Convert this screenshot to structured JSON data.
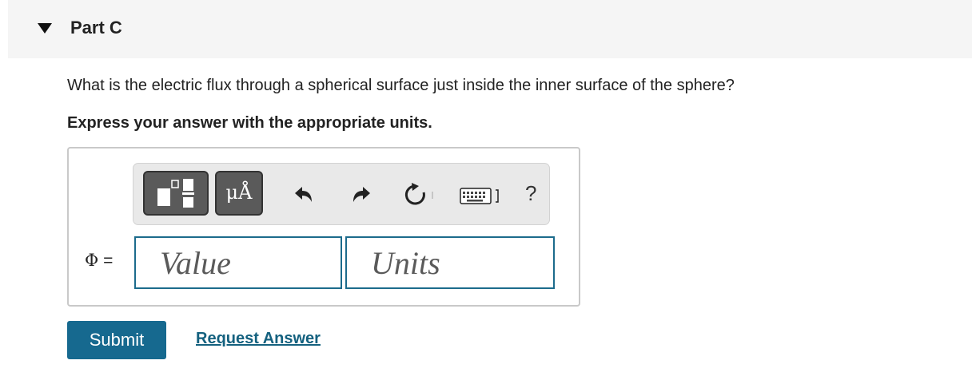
{
  "part": {
    "title": "Part C",
    "toggle_icon": "caret-down-icon"
  },
  "question": {
    "text": "What is the electric flux through a spherical surface just inside the inner surface of the sphere?",
    "instruction": "Express your answer with the appropriate units."
  },
  "toolbar": {
    "templates_icon": "templates-icon",
    "units_label": "μÅ",
    "undo_icon": "undo-icon",
    "redo_icon": "redo-icon",
    "reset_icon": "reset-icon",
    "keyboard_icon": "keyboard-icon",
    "help_label": "?"
  },
  "answer": {
    "symbol": "Φ",
    "equals": "=",
    "value_placeholder": "Value",
    "value": "",
    "units_placeholder": "Units",
    "units": ""
  },
  "actions": {
    "submit_label": "Submit",
    "request_answer_label": "Request Answer"
  },
  "colors": {
    "accent": "#16698f",
    "link": "#14617f",
    "field_border": "#1c6b8c",
    "header_bg": "#f5f5f5"
  }
}
